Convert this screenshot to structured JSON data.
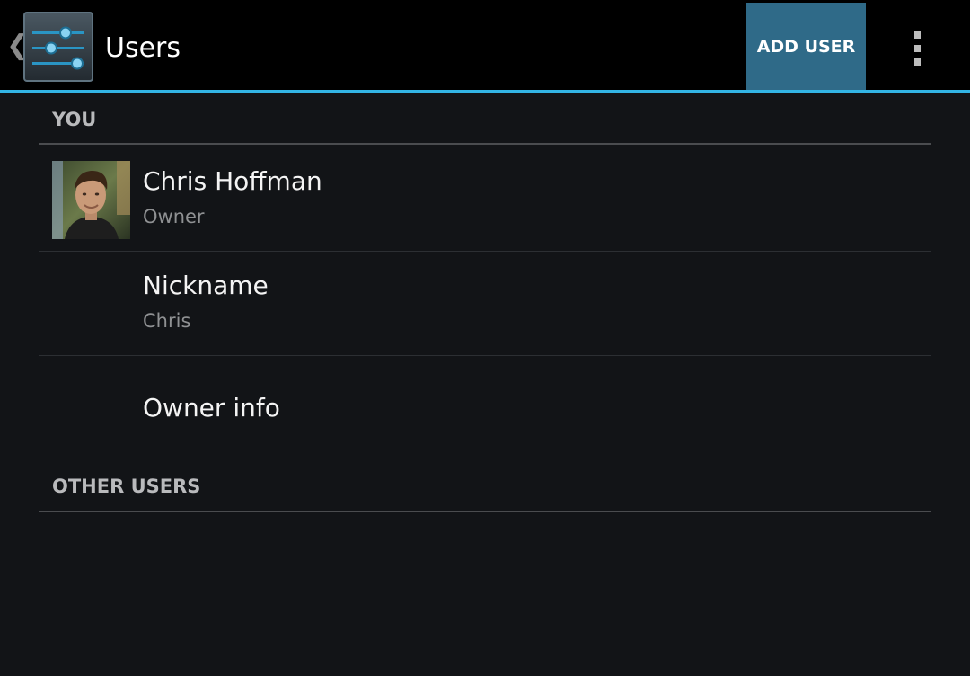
{
  "action_bar": {
    "title": "Users",
    "add_user_label": "ADD USER",
    "accent_color": "#33b5e5",
    "button_color": "#2f6a88"
  },
  "sections": {
    "you_header": "YOU",
    "other_users_header": "OTHER USERS"
  },
  "owner": {
    "name": "Chris Hoffman",
    "role": "Owner"
  },
  "nickname": {
    "title": "Nickname",
    "value": "Chris"
  },
  "owner_info": {
    "title": "Owner info"
  },
  "icons": {
    "back": "chevron-left-icon",
    "app": "settings-sliders-icon",
    "overflow": "more-vertical-icon",
    "avatar": "user-avatar"
  }
}
